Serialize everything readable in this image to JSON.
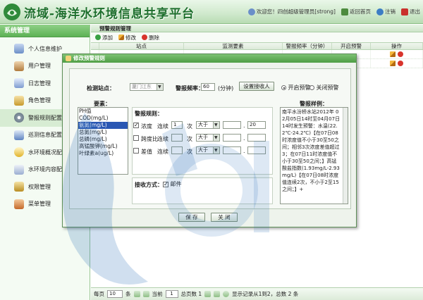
{
  "header": {
    "title": "流域-海洋水环境信息共享平台",
    "welcome": "欢迎您！四创超级管理员[strong]",
    "nav": [
      {
        "label": "返回首页",
        "icon": "home-icon"
      },
      {
        "label": "注销",
        "icon": "refresh-icon"
      },
      {
        "label": "退出",
        "icon": "close-icon"
      }
    ]
  },
  "sidebar": {
    "title": "系统管理",
    "items": [
      {
        "label": "个人信息维护",
        "icon": "user-edit-icon"
      },
      {
        "label": "用户管理",
        "icon": "users-icon"
      },
      {
        "label": "日志管理",
        "icon": "log-icon"
      },
      {
        "label": "角色管理",
        "icon": "role-icon"
      },
      {
        "label": "警报规则配置",
        "icon": "gear-icon"
      },
      {
        "label": "巡测信息配置",
        "icon": "chart-icon"
      },
      {
        "label": "水环境概况配置",
        "icon": "bulb-icon"
      },
      {
        "label": "水环境内容配置",
        "icon": "text-icon"
      },
      {
        "label": "权限管理",
        "icon": "lock-icon"
      },
      {
        "label": "菜单管理",
        "icon": "menu-icon"
      }
    ]
  },
  "main": {
    "title": "预警规则管理",
    "toolbar": {
      "add": "添加",
      "edit": "修改",
      "delete": "删除"
    },
    "columns": [
      "站点",
      "监测要素",
      "警报频率（分钟）",
      "开启预警",
      "操作"
    ],
    "pager": {
      "per_page_label": "每页",
      "per_page_value": "10",
      "unit": "条",
      "current_label": "当前",
      "current_value": "1",
      "total_pages": "总页数 1",
      "status": "显示记录从1到2，总数 2 条"
    }
  },
  "dialog": {
    "title": "修改预警规则",
    "station_label": "检测站点：",
    "station_value": "厦门江东",
    "freq_label": "警报频率：",
    "freq_value": "60",
    "freq_unit": "(分钟)",
    "set_receiver": "设置接收人",
    "radio_on": "开启预警",
    "radio_off": "关闭预警",
    "elements_label": "要素：",
    "elements": [
      "PH值",
      "COD(mg/L)",
      "氨氮(mg/L)",
      "总氮(mg/L)",
      "总磷(mg/L)",
      "高锰酸钾(mg/L)",
      "叶绿素a(ug/L)"
    ],
    "selected_element": "氨氮(mg/L)",
    "rules_label": "警报规则：",
    "rules": [
      {
        "label": "浓度",
        "checked": true,
        "cont_label": "连续",
        "count": "1",
        "unit": "次",
        "op": "大于",
        "a": "",
        "sep": ".",
        "b": "20"
      },
      {
        "label": "跨度比",
        "checked": false,
        "cont_label": "连续",
        "count": "",
        "unit": "次",
        "op": "大于",
        "a": "",
        "sep": ".",
        "b": ""
      },
      {
        "label": "差值",
        "checked": false,
        "cont_label": "连续",
        "count": "",
        "unit": "次",
        "op": "大于",
        "a": "",
        "sep": ".",
        "b": ""
      }
    ],
    "receive_label": "接收方式：",
    "receive_option": "邮件",
    "sample_label": "警报样例：",
    "sample_text": "南平水汾桥水站2012年 02月05日14时至04月07日14时发生预警：水温(22.2℃-24.2℃)【在07日08时浓度值不小于30至50之间；相邻3次浓度差值超过3；在07日11时浓度值不小于30至50之间；】高锰酸盐指数(1.93mg/L-2.93mg/L)【在07日08时浓度值连续2次，不小于2至15之间；】+",
    "save": "保 存",
    "close": "关 闭"
  },
  "colors": {
    "brand_green": "#1d6f2c",
    "accent_green": "#5db255",
    "selection_blue": "#2a57b3"
  }
}
